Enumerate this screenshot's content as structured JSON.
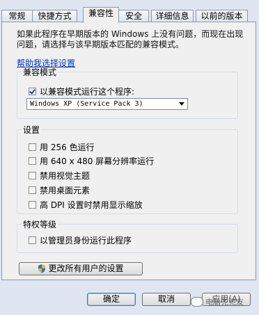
{
  "tabs": [
    "常规",
    "快捷方式",
    "兼容性",
    "安全",
    "详细信息",
    "以前的版本"
  ],
  "active_tab": "兼容性",
  "intro_text": "如果此程序在早期版本的 Windows 上没有问题，而现在出现问题，请选择与该早期版本匹配的兼容模式。",
  "help_link": "帮助我选择设置",
  "compat_group": {
    "title": "兼容模式",
    "checkbox_label": "以兼容模式运行这个程序:",
    "checked": true,
    "selected_os": "Windows XP (Service Pack 3)"
  },
  "settings_group": {
    "title": "设置",
    "items": [
      {
        "label": "用 256 色运行",
        "checked": false
      },
      {
        "label": "用 640 x 480 屏幕分辨率运行",
        "checked": false
      },
      {
        "label": "禁用视觉主题",
        "checked": false
      },
      {
        "label": "禁用桌面元素",
        "checked": false
      },
      {
        "label": "高 DPI 设置时禁用显示缩放",
        "checked": false
      }
    ]
  },
  "privilege_group": {
    "title": "特权等级",
    "checkbox_label": "以管理员身份运行此程序",
    "checked": false
  },
  "change_all_button": "更改所有用户的设置",
  "buttons": {
    "ok": "确定",
    "cancel": "取消",
    "apply": "应用(A)"
  },
  "watermark": "电脑兜兜友",
  "colors": {
    "link": "#0033cc",
    "panel": "#f0f0f0",
    "frame": "#dfe6f1"
  }
}
